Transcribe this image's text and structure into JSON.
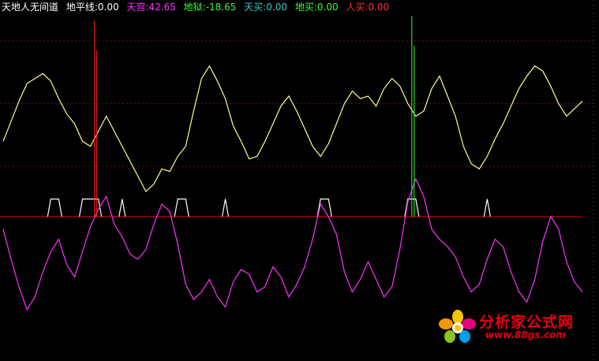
{
  "legend": {
    "indicator_name": "天地人无间道",
    "items": [
      {
        "text": "地平线:0.00",
        "color": "#ffffff"
      },
      {
        "text": "天宫:42.65",
        "color": "#ff33ff"
      },
      {
        "text": "地狱:-18.65",
        "color": "#33ff33"
      },
      {
        "text": "天买:0.00",
        "color": "#33cccc"
      },
      {
        "text": "地买:0.00",
        "color": "#33ff33"
      },
      {
        "text": "人买:0.00",
        "color": "#ff3333"
      }
    ]
  },
  "watermark": {
    "title": "分析家公式网",
    "url": "www.88gs.com"
  },
  "chart_data": {
    "type": "line",
    "x": [
      0,
      1,
      2,
      3,
      4,
      5,
      6,
      7,
      8,
      9,
      10,
      11,
      12,
      13,
      14,
      15,
      16,
      17,
      18,
      19,
      20,
      21,
      22,
      23,
      24,
      25,
      26,
      27,
      28,
      29,
      30,
      31,
      32,
      33,
      34,
      35,
      36,
      37,
      38,
      39,
      40,
      41,
      42,
      43,
      44,
      45,
      46,
      47,
      48,
      49,
      50,
      51,
      52,
      53,
      54,
      55,
      56,
      57,
      58,
      59,
      60,
      61,
      62,
      63,
      64,
      65,
      66,
      67,
      68,
      69,
      70,
      71,
      72,
      73
    ],
    "ylim": [
      -55,
      80
    ],
    "reference_lines": [
      {
        "name": "地平线",
        "value": 0,
        "color": "#cc0000"
      },
      {
        "value": 20,
        "color": "#661010",
        "dashed": true
      },
      {
        "value": 45,
        "color": "#661010",
        "dashed": true
      },
      {
        "value": 70,
        "color": "#661010",
        "dashed": true
      }
    ],
    "series": [
      {
        "color": "#ffff88",
        "values": [
          30,
          38,
          46,
          53,
          55,
          57,
          54,
          47,
          41,
          37,
          30,
          28,
          34,
          40,
          34,
          28,
          22,
          16,
          10,
          13,
          19,
          18,
          24,
          28,
          42,
          55,
          60,
          54,
          47,
          36,
          30,
          23,
          24,
          30,
          37,
          44,
          48,
          42,
          35,
          28,
          24,
          29,
          37,
          45,
          50,
          47,
          48,
          44,
          51,
          55,
          52,
          45,
          40,
          42,
          51,
          56,
          48,
          40,
          28,
          21,
          19,
          24,
          31,
          37,
          44,
          51,
          56,
          60,
          58,
          52,
          45,
          40,
          43,
          46
        ]
      },
      {
        "color": "#ff33ff",
        "values": [
          -5,
          -17,
          -28,
          -37,
          -32,
          -22,
          -14,
          -9,
          -19,
          -24,
          -14,
          -4,
          3,
          8,
          -3,
          -8,
          -15,
          -17,
          -13,
          -3,
          5,
          2,
          -11,
          -27,
          -33,
          -30,
          -25,
          -32,
          -36,
          -26,
          -21,
          -23,
          -30,
          -28,
          -20,
          -24,
          -32,
          -27,
          -20,
          -9,
          5,
          0,
          -7,
          -22,
          -30,
          -25,
          -18,
          -25,
          -32,
          -28,
          -13,
          6,
          15,
          8,
          -5,
          -9,
          -12,
          -16,
          -24,
          -30,
          -27,
          -17,
          -9,
          -12,
          -22,
          -30,
          -34,
          -25,
          -10,
          0,
          -5,
          -18,
          -26,
          -30
        ]
      }
    ],
    "step_series": {
      "color": "#ffffff",
      "baseline": 0,
      "level": 7,
      "pulses": [
        [
          6,
          7
        ],
        [
          10,
          12
        ],
        [
          15,
          15
        ],
        [
          22,
          23
        ],
        [
          28,
          28
        ],
        [
          40,
          41
        ],
        [
          51,
          52
        ],
        [
          61,
          61
        ]
      ]
    },
    "spikes": [
      {
        "x": 11.5,
        "min": 0,
        "max": 78,
        "color": "#ff2222"
      },
      {
        "x": 51.5,
        "min": 0,
        "max": 80,
        "color": "#33ff33"
      }
    ]
  }
}
